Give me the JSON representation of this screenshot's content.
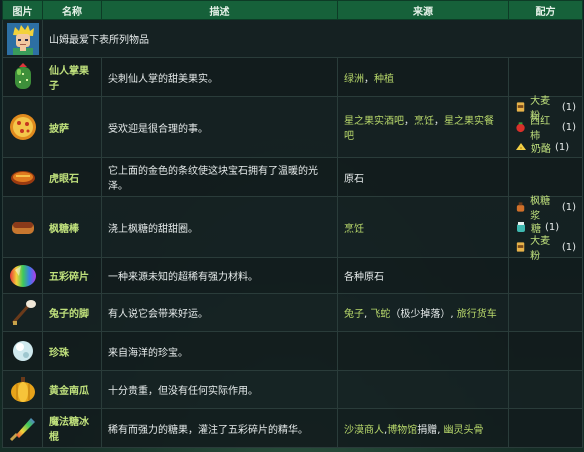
{
  "headers": {
    "image": "图片",
    "name": "名称",
    "desc": "描述",
    "source": "来源",
    "recipe": "配方"
  },
  "intro": "山姆最爱下表所列物品",
  "rows": [
    {
      "icon": "cactus-fruit-icon",
      "name": "仙人掌果子",
      "desc": "尖刺仙人掌的甜美果实。",
      "source": [
        {
          "text": "绿洲",
          "link": true
        },
        {
          "text": "，",
          "link": false
        },
        {
          "text": "种植",
          "link": true
        }
      ],
      "recipe": []
    },
    {
      "icon": "pizza-icon",
      "name": "披萨",
      "desc": "受欢迎是很合理的事。",
      "source": [
        {
          "text": "星之果实酒吧",
          "link": true
        },
        {
          "text": "，",
          "link": false
        },
        {
          "text": "烹饪",
          "link": true
        },
        {
          "text": "，",
          "link": false
        },
        {
          "text": "星之果实餐吧",
          "link": true
        }
      ],
      "recipe": [
        {
          "icon": "wheat-flour-icon",
          "name": "大麦粉",
          "qty": "(1)"
        },
        {
          "icon": "tomato-icon",
          "name": "西红柿",
          "qty": "(1)"
        },
        {
          "icon": "cheese-icon",
          "name": "奶酪",
          "qty": "(1)"
        }
      ]
    },
    {
      "icon": "tigers-eye-icon",
      "name": "虎眼石",
      "desc": "它上面的金色的条纹使这块宝石拥有了温暖的光泽。",
      "source": [
        {
          "text": "原石",
          "link": false
        }
      ],
      "recipe": []
    },
    {
      "icon": "maple-bar-icon",
      "name": "枫糖棒",
      "desc": "浇上枫糖的甜甜圈。",
      "source": [
        {
          "text": "烹饪",
          "link": true
        }
      ],
      "recipe": [
        {
          "icon": "maple-syrup-icon",
          "name": "枫糖浆",
          "qty": "(1)"
        },
        {
          "icon": "sugar-icon",
          "name": "糖",
          "qty": "(1)"
        },
        {
          "icon": "wheat-flour-icon",
          "name": "大麦粉",
          "qty": "(1)"
        }
      ]
    },
    {
      "icon": "prismatic-shard-icon",
      "name": "五彩碎片",
      "desc": "一种来源未知的超稀有强力材料。",
      "source": [
        {
          "text": "各种原石",
          "link": false
        }
      ],
      "recipe": []
    },
    {
      "icon": "rabbits-foot-icon",
      "name": "兔子的脚",
      "desc": "有人说它会带来好运。",
      "source": [
        {
          "text": "兔子",
          "link": true
        },
        {
          "text": ", ",
          "link": false
        },
        {
          "text": "飞蛇",
          "link": true
        },
        {
          "text": "（极少掉落）, ",
          "link": false
        },
        {
          "text": "旅行货车",
          "link": true
        }
      ],
      "recipe": []
    },
    {
      "icon": "pearl-icon",
      "name": "珍珠",
      "desc": "来自海洋的珍宝。",
      "source": [],
      "recipe": []
    },
    {
      "icon": "golden-pumpkin-icon",
      "name": "黄金南瓜",
      "desc": "十分贵重，但没有任何实际作用。",
      "source": [],
      "recipe": []
    },
    {
      "icon": "magic-rock-candy-icon",
      "name": "魔法糖冰棍",
      "desc": "稀有而强力的糖果，灌注了五彩碎片的精华。",
      "source": [
        {
          "text": "沙漠商人",
          "link": true
        },
        {
          "text": ",",
          "link": false
        },
        {
          "text": "博物馆",
          "link": true
        },
        {
          "text": "捐赠",
          "link": false
        },
        {
          "text": ", ",
          "link": false
        },
        {
          "text": "幽灵头骨",
          "link": true
        }
      ],
      "recipe": []
    }
  ]
}
